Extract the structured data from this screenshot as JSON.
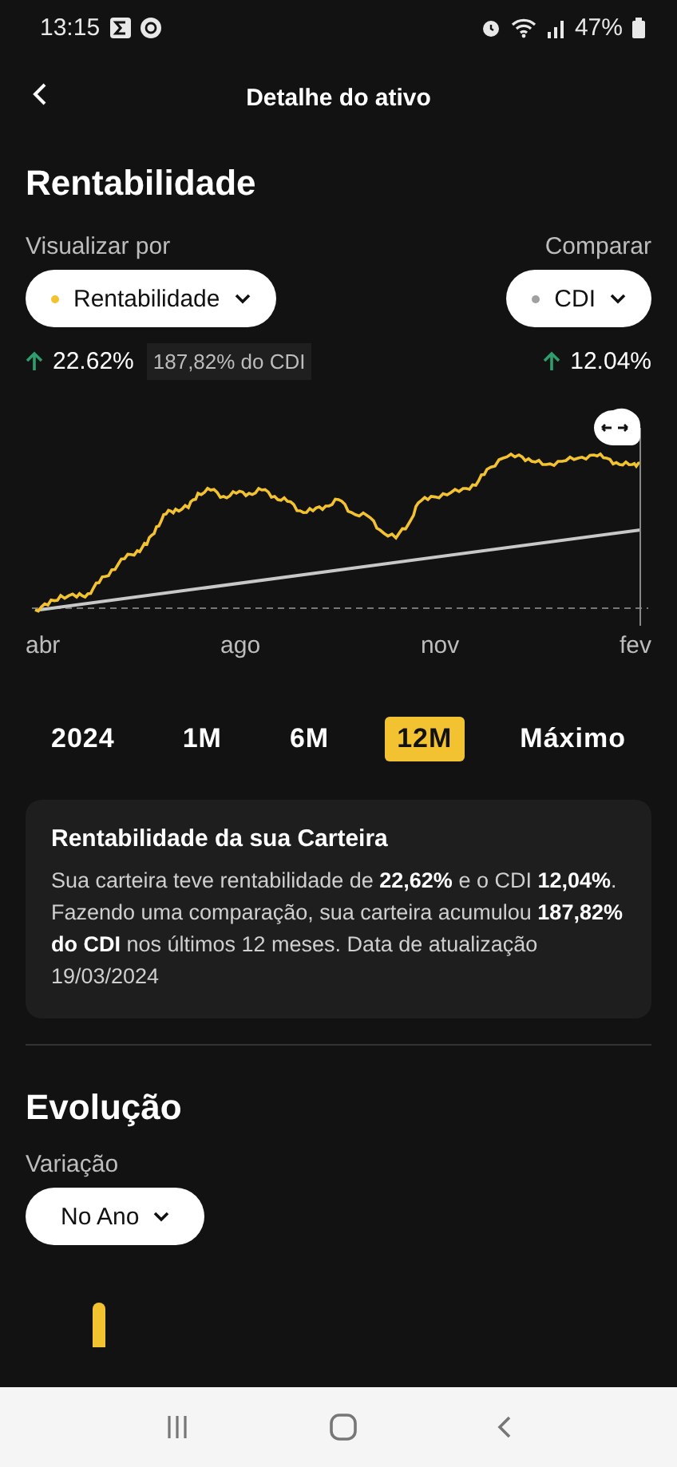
{
  "status_bar": {
    "time": "13:15",
    "battery": "47%"
  },
  "header": {
    "title": "Detalhe do ativo"
  },
  "rentabilidade": {
    "title": "Rentabilidade",
    "view_by": {
      "label": "Visualizar por",
      "value": "Rentabilidade",
      "color": "#f2c230"
    },
    "compare": {
      "label": "Comparar",
      "value": "CDI",
      "color": "#a0a0a0"
    },
    "return": "22.62%",
    "cdi_ratio": "187,82% do CDI",
    "compare_return": "12.04%"
  },
  "chart": {
    "x_labels": [
      "abr",
      "ago",
      "nov",
      "fev"
    ]
  },
  "periods": [
    {
      "label": "2024",
      "selected": false
    },
    {
      "label": "1M",
      "selected": false
    },
    {
      "label": "6M",
      "selected": false
    },
    {
      "label": "12M",
      "selected": true
    },
    {
      "label": "Máximo",
      "selected": false
    }
  ],
  "summary": {
    "title": "Rentabilidade da sua Carteira",
    "text": "Sua carteira teve rentabilidade de **22,62%** e o CDI **12,04%**. Fazendo uma comparação, sua carteira acumulou **187,82% do CDI** nos últimos 12 meses. Data de atualização 19/03/2024"
  },
  "evolucao": {
    "title": "Evolução",
    "variation": {
      "label": "Variação",
      "value": "No Ano"
    }
  }
}
